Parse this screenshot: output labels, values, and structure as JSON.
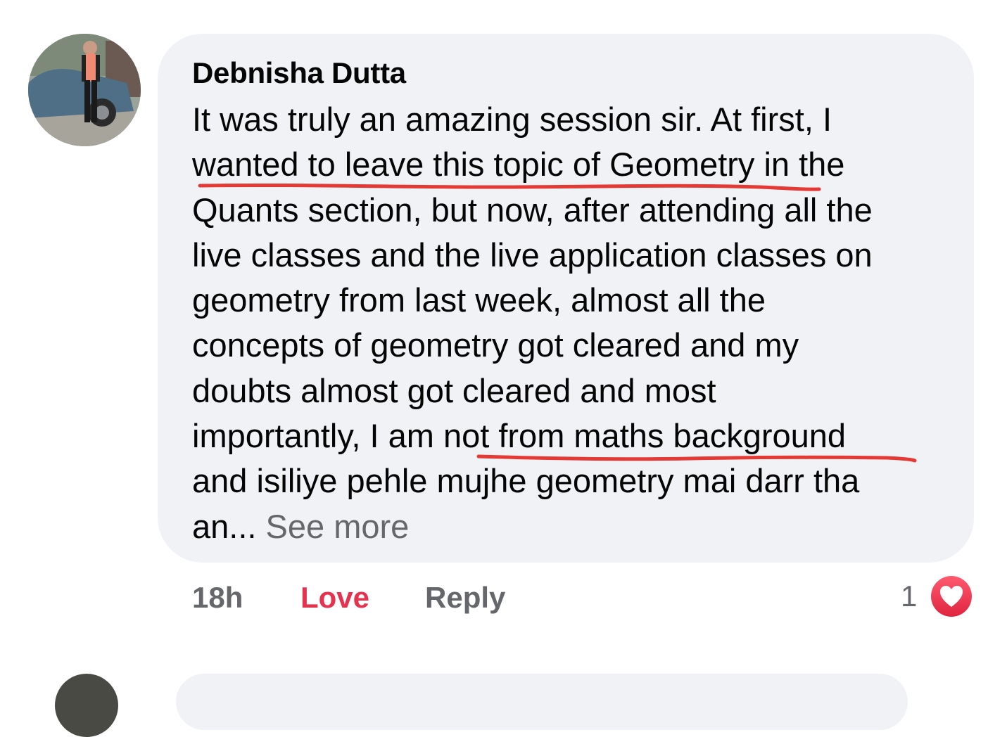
{
  "comment": {
    "author": "Debnisha Dutta",
    "lines": [
      "It was truly an amazing session sir. At first, I",
      "wanted to leave this topic of Geometry in the",
      "Quants section, but now, after attending all the",
      "live classes and the live application classes on",
      "geometry from last week, almost all the",
      "concepts of geometry got cleared and my",
      "doubts almost got cleared and most",
      "importantly, I am not from maths background",
      "and isiliye pehle mujhe geometry mai darr tha"
    ],
    "last_line_prefix": "an...",
    "see_more": "See more",
    "annotation_color": "#e53935"
  },
  "actions": {
    "time": "18h",
    "love": "Love",
    "reply": "Reply",
    "reaction_count": "1",
    "reaction_icon": "heart-icon",
    "love_color": "#e4334f"
  }
}
